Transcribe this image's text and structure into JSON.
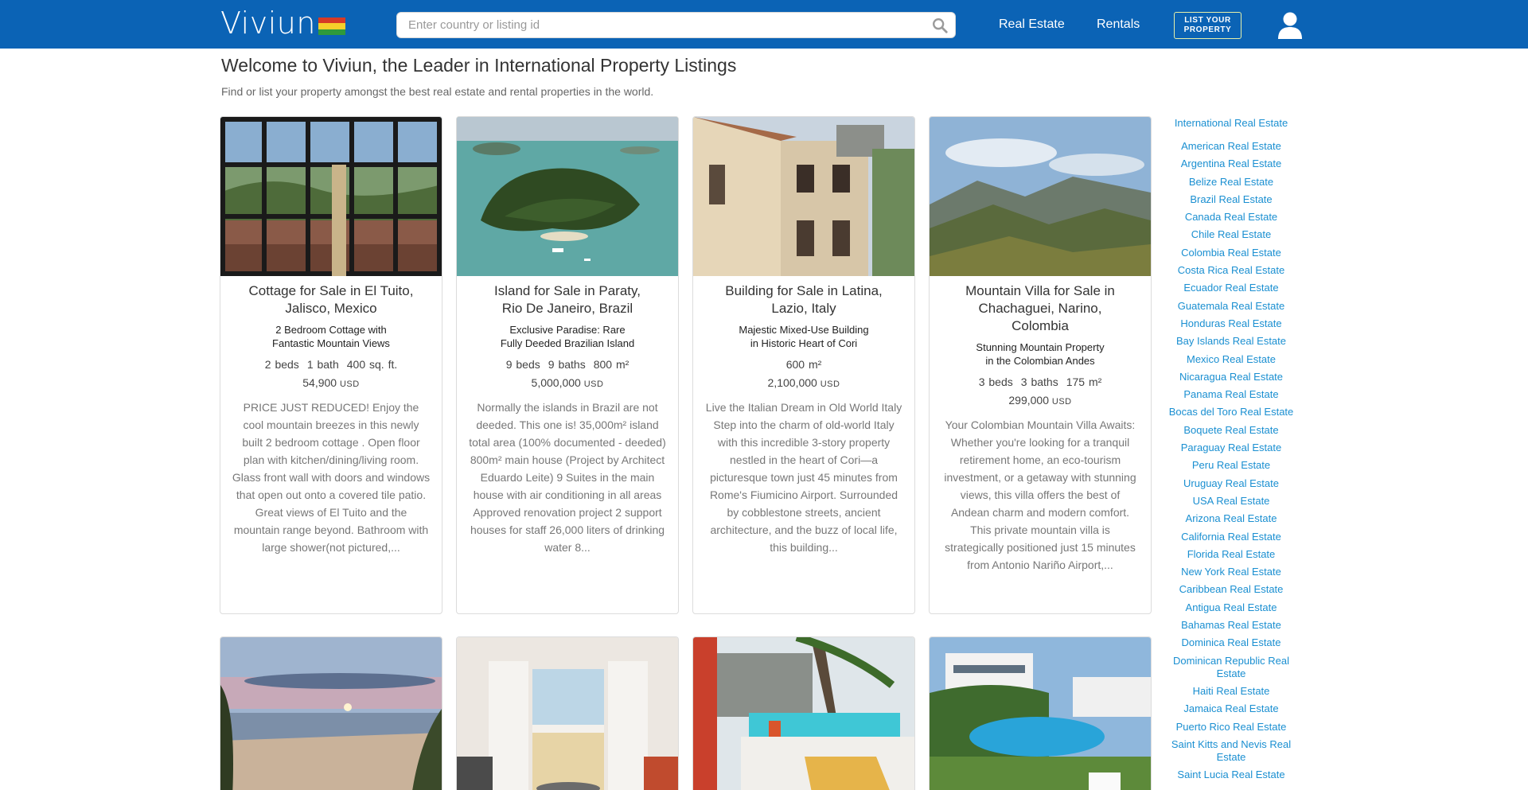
{
  "header": {
    "logo_text": "Viviun",
    "logo_flag_colors": [
      "#d63a26",
      "#f6d02a",
      "#2f9a3a"
    ],
    "search_placeholder": "Enter country or listing id",
    "nav_real_estate": "Real Estate",
    "nav_rentals": "Rentals",
    "list_property_line1": "LIST YOUR",
    "list_property_line2": "PROPERTY"
  },
  "intro": {
    "title": "Welcome to Viviun, the Leader in International Property Listings",
    "subtitle": "Find or list your property amongst the best real estate and rental properties in the world."
  },
  "listings": [
    {
      "title": "Cottage for Sale in El Tuito, Jalisco, Mexico",
      "subtitle": "2 Bedroom Cottage with Fantastic Mountain Views",
      "beds": "2 beds",
      "baths": "1 bath",
      "area": "400 sq. ft.",
      "price": "54,900",
      "currency": "USD",
      "description": "PRICE JUST REDUCED! Enjoy the cool mountain breezes in this newly built 2 bedroom cottage . Open floor plan with kitchen/dining/living room. Glass front wall with doors and windows that open out onto a covered tile patio. Great views of El Tuito and the mountain range beyond. Bathroom with large shower(not pictured,..."
    },
    {
      "title": "Island for Sale in Paraty, Rio De Janeiro, Brazil",
      "subtitle": "Exclusive Paradise: Rare Fully Deeded Brazilian Island",
      "beds": "9 beds",
      "baths": "9 baths",
      "area": "800 m²",
      "price": "5,000,000",
      "currency": "USD",
      "description": "Normally the islands in Brazil are not deeded. This one is! 35,000m² island total area (100% documented - deeded) 800m² main house (Project by Architect Eduardo Leite) 9 Suites in the main house with air conditioning in all areas Approved renovation project 2 support houses for staff 26,000 liters of drinking water 8..."
    },
    {
      "title": "Building for Sale in Latina, Lazio, Italy",
      "subtitle": "Majestic Mixed-Use Building in Historic Heart of Cori",
      "beds": "",
      "baths": "",
      "area": "600 m²",
      "price": "2,100,000",
      "currency": "USD",
      "description": "Live the Italian Dream in Old World Italy Step into the charm of old-world Italy with this incredible 3-story property nestled in the heart of Cori—a picturesque town just 45 minutes from Rome's Fiumicino Airport. Surrounded by cobblestone streets, ancient architecture, and the buzz of local life, this building..."
    },
    {
      "title": "Mountain Villa for Sale in Chachaguei, Narino, Colombia",
      "subtitle": "Stunning Mountain Property in the Colombian Andes",
      "beds": "3 beds",
      "baths": "3 baths",
      "area": "175 m²",
      "price": "299,000",
      "currency": "USD",
      "description": "Your Colombian Mountain Villa Awaits: Whether you're looking for a tranquil retirement home, an eco-tourism investment, or a getaway with stunning views, this villa offers the best of Andean charm and modern comfort. This private mountain villa is strategically positioned just 15 minutes from Antonio Nariño Airport,..."
    }
  ],
  "sidebar": {
    "heading": "International Real Estate",
    "links": [
      "American Real Estate",
      "Argentina Real Estate",
      "Belize Real Estate",
      "Brazil Real Estate",
      "Canada Real Estate",
      "Chile Real Estate",
      "Colombia Real Estate",
      "Costa Rica Real Estate",
      "Ecuador Real Estate",
      "Guatemala Real Estate",
      "Honduras Real Estate",
      "Bay Islands Real Estate",
      "Mexico Real Estate",
      "Nicaragua Real Estate",
      "Panama Real Estate",
      "Bocas del Toro Real Estate",
      "Boquete Real Estate",
      "Paraguay Real Estate",
      "Peru Real Estate",
      "Uruguay Real Estate",
      "USA Real Estate",
      "Arizona Real Estate",
      "California Real Estate",
      "Florida Real Estate",
      "New York Real Estate",
      "Caribbean Real Estate",
      "Antigua Real Estate",
      "Bahamas Real Estate",
      "Dominica Real Estate",
      "Dominican Republic Real Estate",
      "Haiti Real Estate",
      "Jamaica Real Estate",
      "Puerto Rico Real Estate",
      "Saint Kitts and Nevis Real Estate",
      "Saint Lucia Real Estate"
    ]
  }
}
